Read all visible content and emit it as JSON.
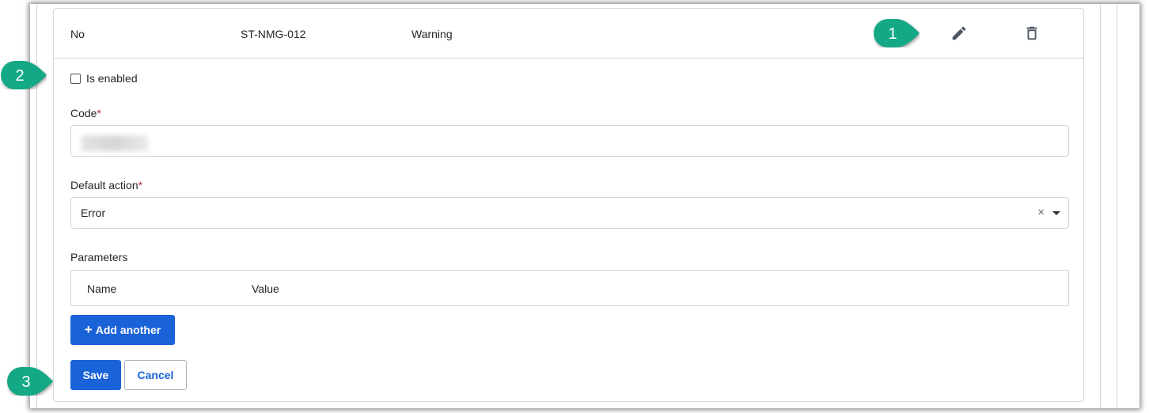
{
  "row": {
    "enabled": "No",
    "code": "ST-NMG-012",
    "action": "Warning",
    "edit_icon": "pencil-icon",
    "delete_icon": "trash-icon"
  },
  "form": {
    "is_enabled_label": "Is enabled",
    "is_enabled_checked": false,
    "code_label": "Code",
    "required_mark": "*",
    "default_action_label": "Default action",
    "default_action_value": "Error",
    "clear_glyph": "×",
    "parameters_label": "Parameters",
    "parameters_columns": [
      "Name",
      "Value"
    ],
    "add_another_label": "Add another",
    "add_glyph": "+",
    "save_label": "Save",
    "cancel_label": "Cancel"
  },
  "callouts": [
    "1",
    "2",
    "3"
  ],
  "colors": {
    "primary": "#1a62d8",
    "callout": "#13a886",
    "required": "#b02a37"
  }
}
